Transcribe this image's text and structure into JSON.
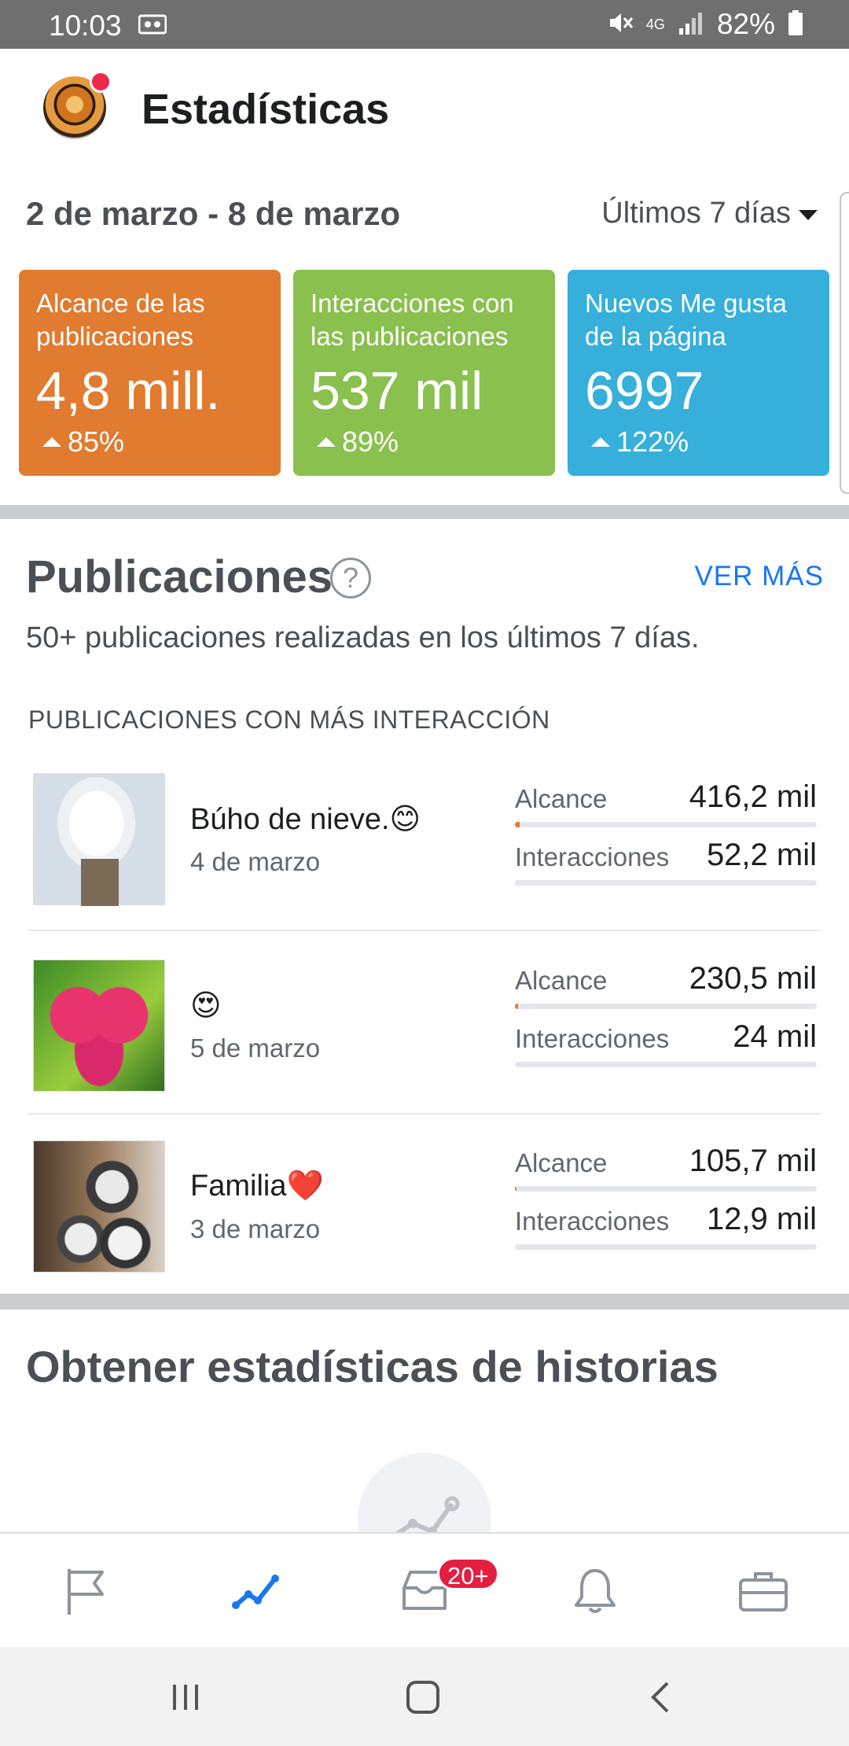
{
  "status_bar": {
    "time": "10:03",
    "battery": "82%",
    "network": "4G"
  },
  "header": {
    "title": "Estadísticas"
  },
  "overview": {
    "date_range": "2 de marzo - 8 de marzo",
    "period": "Últimos 7 días",
    "cards": [
      {
        "label": "Alcance de las publicaciones",
        "value": "4,8 mill.",
        "change": "85%",
        "color": "#e07b30"
      },
      {
        "label": "Interacciones con las publicaciones",
        "value": "537 mil",
        "change": "89%",
        "color": "#8ac04e"
      },
      {
        "label": "Nuevos Me gusta de la página",
        "value": "6997",
        "change": "122%",
        "color": "#36afdb"
      }
    ]
  },
  "publications": {
    "title": "Publicaciones",
    "help": "?",
    "see_more": "VER MÁS",
    "subtitle": "50+ publicaciones realizadas en los últimos 7 días.",
    "section_label": "PUBLICACIONES CON MÁS INTERACCIÓN",
    "posts": [
      {
        "title": "Búho de nieve.😊",
        "date": "4 de marzo",
        "reach_label": "Alcance",
        "reach": "416,2 mil",
        "reach_fraction": 0.015,
        "interactions_label": "Interacciones",
        "interactions": "52,2 mil",
        "interactions_fraction": 0.0
      },
      {
        "title": "😍",
        "date": "5 de marzo",
        "reach_label": "Alcance",
        "reach": "230,5 mil",
        "reach_fraction": 0.01,
        "interactions_label": "Interacciones",
        "interactions": "24 mil",
        "interactions_fraction": 0.0
      },
      {
        "title": "Familia❤️",
        "date": "3 de marzo",
        "reach_label": "Alcance",
        "reach": "105,7 mil",
        "reach_fraction": 0.005,
        "interactions_label": "Interacciones",
        "interactions": "12,9 mil",
        "interactions_fraction": 0.0
      }
    ]
  },
  "stories": {
    "title": "Obtener estadísticas de historias"
  },
  "bottom_nav": {
    "badge": "20+",
    "active_color": "#1877f2",
    "items": [
      "flag-icon",
      "insights-icon",
      "inbox-icon",
      "bell-icon",
      "briefcase-icon"
    ]
  },
  "colors": {
    "accent": "#1877f2",
    "divider": "#c9ccd1"
  }
}
